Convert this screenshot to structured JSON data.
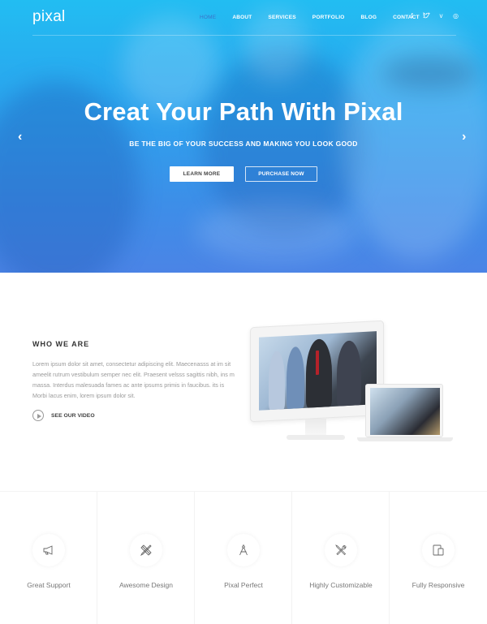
{
  "header": {
    "logo": "pixal",
    "nav": [
      {
        "label": "HOME",
        "active": true
      },
      {
        "label": "ABOUT",
        "active": false
      },
      {
        "label": "SERVICES",
        "active": false
      },
      {
        "label": "PORTFOLIO",
        "active": false
      },
      {
        "label": "BLOG",
        "active": false
      },
      {
        "label": "CONTACT",
        "active": false
      }
    ],
    "social_icons": [
      "facebook-icon",
      "twitter-icon",
      "vimeo-icon",
      "dribbble-icon"
    ],
    "social_glyphs": [
      "f",
      "t",
      "v",
      "◎"
    ]
  },
  "hero": {
    "title": "Creat Your Path With Pixal",
    "subtitle": "BE THE BIG OF YOUR SUCCESS AND MAKING YOU LOOK GOOD",
    "learn_more": "LEARN MORE",
    "purchase_now": "PURCHASE NOW",
    "prev_glyph": "‹",
    "next_glyph": "›"
  },
  "about": {
    "title": "WHO WE ARE",
    "text": "Lorem ipsum dolor sit amet, consectetur adipiscing elit. Maecenasss at im sit ameelit rutrum vestibulum semper nec elit. Praesent velsss sagittis nibh, ins m massa. Interdus malesuada fames ac ante ipsums primis in faucibus. its is Morbi lacus enim, lorem ipsum dolor sit.",
    "video_label": "SEE OUR VIDEO"
  },
  "features": [
    {
      "label": "Great Support",
      "icon": "megaphone-icon"
    },
    {
      "label": "Awesome Design",
      "icon": "pencil-ruler-icon"
    },
    {
      "label": "Pixal Perfect",
      "icon": "compass-icon"
    },
    {
      "label": "Highly Customizable",
      "icon": "tools-icon"
    },
    {
      "label": "Fully Responsive",
      "icon": "devices-icon"
    }
  ],
  "colors": {
    "hero_top": "#22bdf2",
    "hero_bottom": "#4b84e6",
    "nav_active": "#3a73c9"
  }
}
